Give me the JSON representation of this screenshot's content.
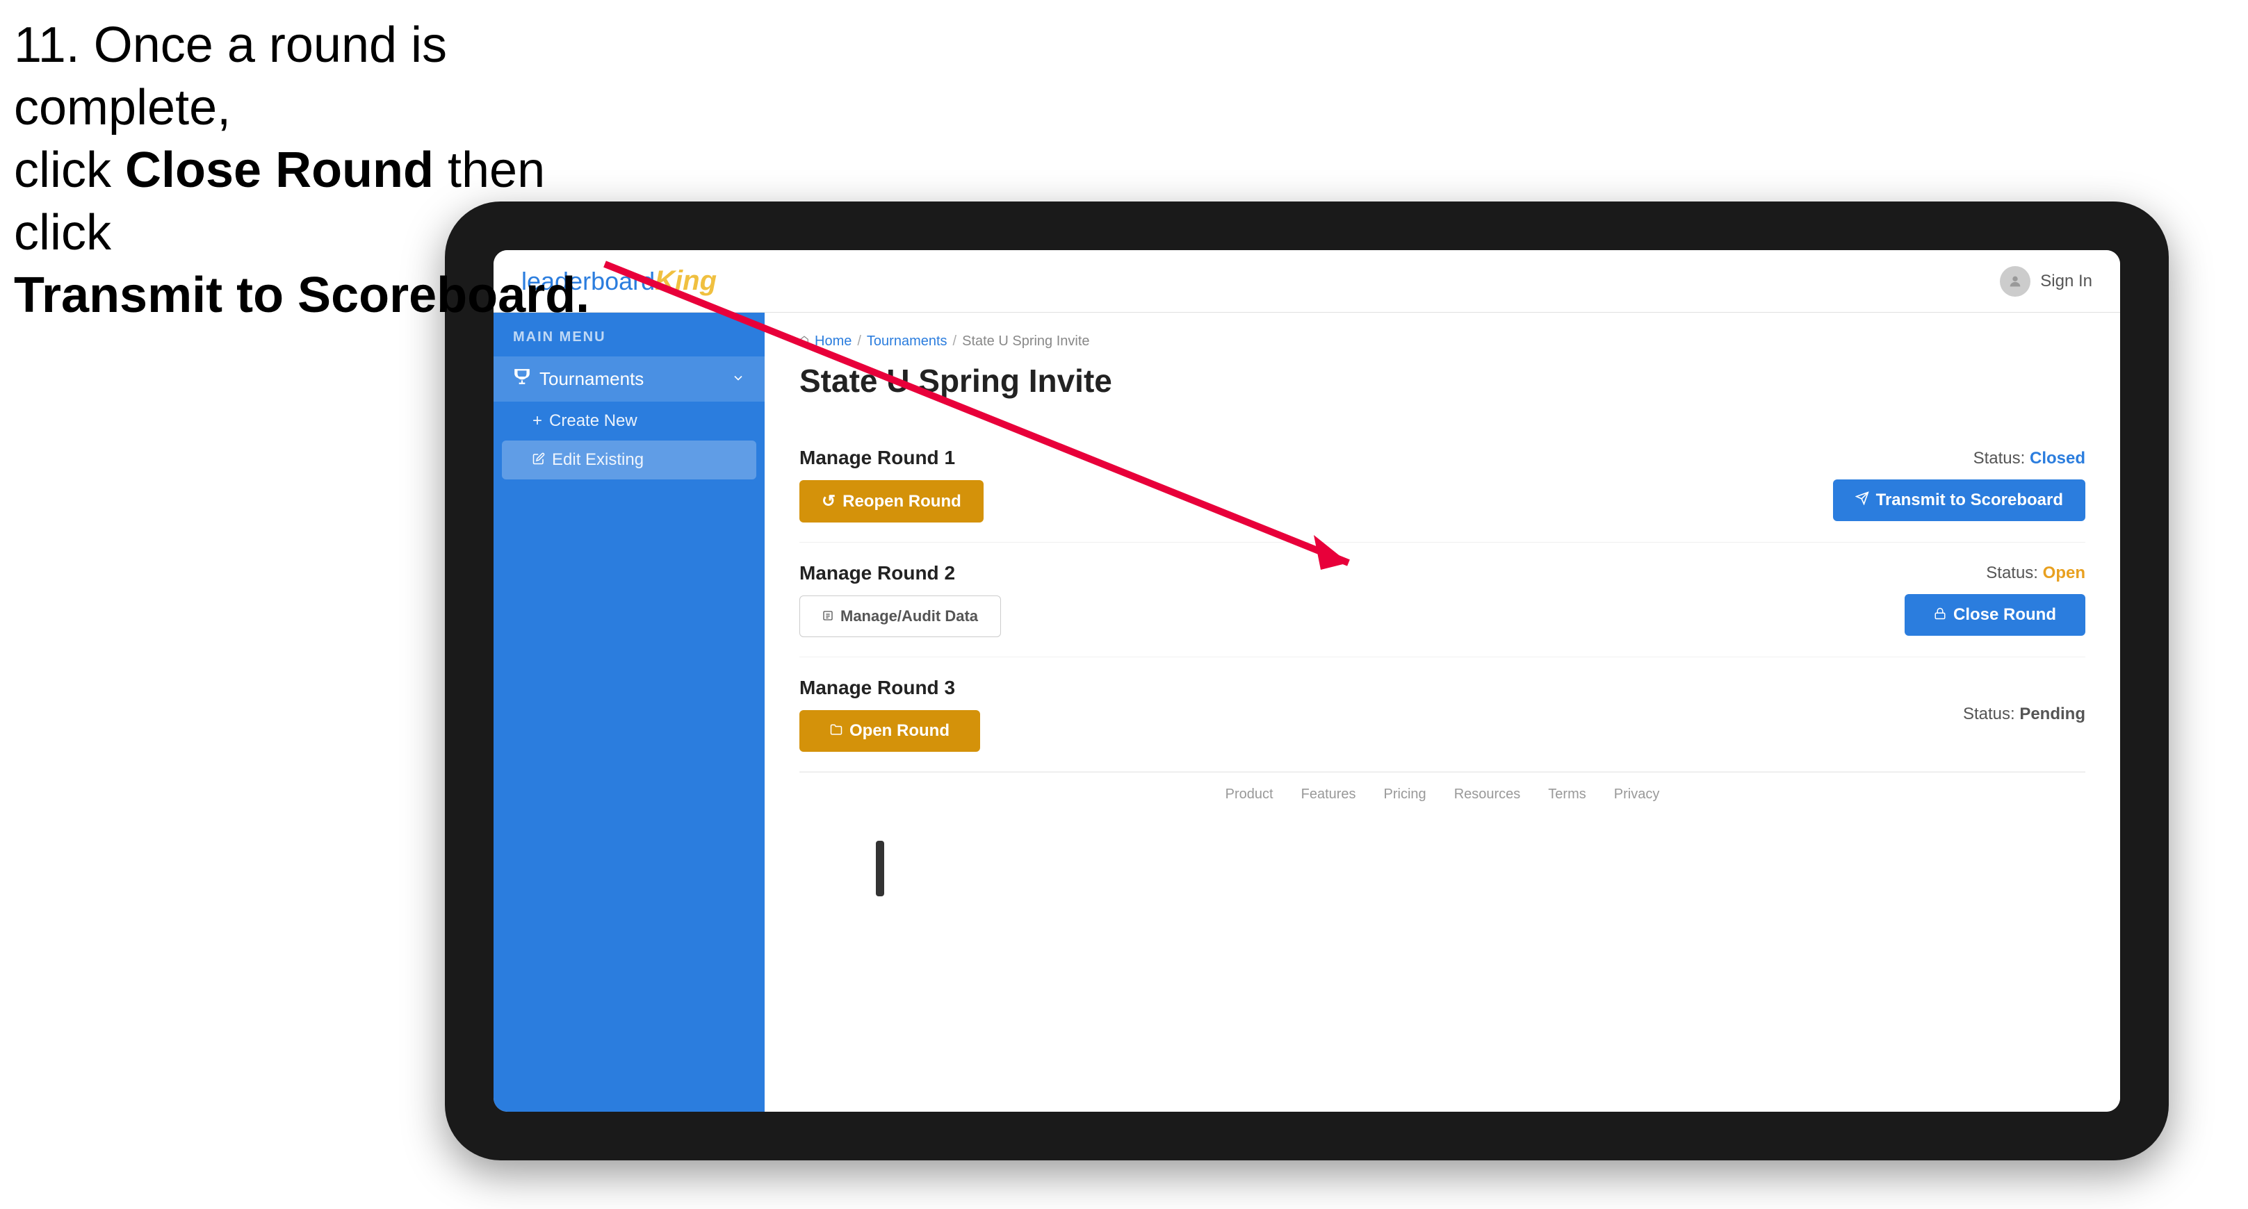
{
  "instruction": {
    "line1": "11. Once a round is complete,",
    "line2": "click ",
    "bold1": "Close Round",
    "line3": " then click",
    "bold2": "Transmit to Scoreboard."
  },
  "nav": {
    "logo": "leaderboard",
    "logo_king": "King",
    "sign_in": "Sign In"
  },
  "sidebar": {
    "main_menu_label": "MAIN MENU",
    "items": [
      {
        "label": "Tournaments",
        "icon": "trophy"
      }
    ],
    "sub_items": [
      {
        "label": "Create New",
        "icon": "plus"
      },
      {
        "label": "Edit Existing",
        "icon": "edit",
        "selected": true
      }
    ]
  },
  "breadcrumb": {
    "home": "Home",
    "sep1": "/",
    "tournaments": "Tournaments",
    "sep2": "/",
    "current": "State U Spring Invite"
  },
  "page": {
    "title": "State U Spring Invite",
    "rounds": [
      {
        "id": "round1",
        "title": "Manage Round 1",
        "status_label": "Status:",
        "status_value": "Closed",
        "status_class": "status-closed",
        "buttons": [
          {
            "label": "Reopen Round",
            "style": "btn-orange",
            "icon": "↺"
          },
          {
            "label": "Transmit to Scoreboard",
            "style": "btn-blue",
            "icon": "➤"
          }
        ]
      },
      {
        "id": "round2",
        "title": "Manage Round 2",
        "status_label": "Status:",
        "status_value": "Open",
        "status_class": "status-open",
        "buttons": [
          {
            "label": "Manage/Audit Data",
            "style": "btn-outline",
            "icon": "☰"
          },
          {
            "label": "Close Round",
            "style": "btn-blue",
            "icon": "🔒"
          }
        ]
      },
      {
        "id": "round3",
        "title": "Manage Round 3",
        "status_label": "Status:",
        "status_value": "Pending",
        "status_class": "status-pending",
        "buttons": [
          {
            "label": "Open Round",
            "style": "btn-orange",
            "icon": "📂"
          }
        ]
      }
    ]
  },
  "footer": {
    "links": [
      "Product",
      "Features",
      "Pricing",
      "Resources",
      "Terms",
      "Privacy"
    ]
  }
}
